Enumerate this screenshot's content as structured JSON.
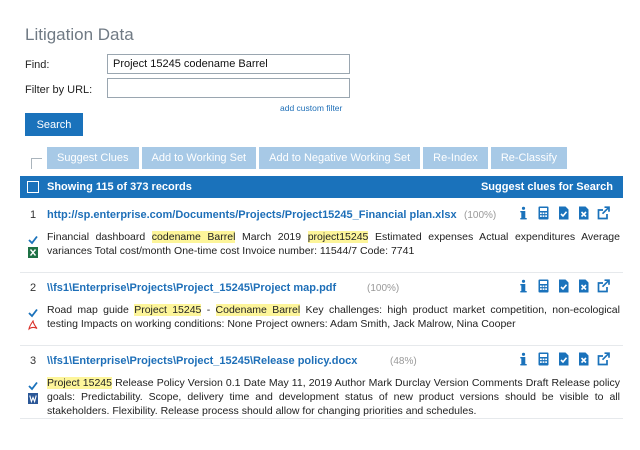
{
  "page_title": "Litigation Data",
  "find": {
    "label": "Find:",
    "value": "Project 15245 codename Barrel"
  },
  "filter_url": {
    "label": "Filter by URL:",
    "value": ""
  },
  "add_filter_link": "add custom filter",
  "search_button": "Search",
  "actions": [
    "Suggest Clues",
    "Add to Working Set",
    "Add to Negative Working Set",
    "Re-Index",
    "Re-Classify"
  ],
  "results_header": {
    "count_text": "Showing 115 of 373 records",
    "suggest_link": "Suggest clues for Search"
  },
  "result_icon_names": [
    "info-icon",
    "calculator-icon",
    "document-check-icon",
    "document-delete-icon",
    "external-link-icon"
  ],
  "colors": {
    "accent": "#1a72bb",
    "action_button": "#a7c9e6",
    "highlight": "#fdf59a",
    "link": "#1e6fb8",
    "check": "#1a72bb",
    "excel": "#1e7145",
    "pdf": "#d9322b",
    "word": "#2b5797"
  },
  "results": [
    {
      "number": "1",
      "url": "http://sp.enterprise.com/Documents/Projects/Project15245_Financial plan.xlsx",
      "score": "(100%)",
      "file_type": "excel-icon",
      "snippet": [
        {
          "t": "Financial dashboard "
        },
        {
          "t": "codename Barrel",
          "hl": true
        },
        {
          "t": " March 2019 "
        },
        {
          "t": "project15245",
          "hl": true
        },
        {
          "t": " Estimated expenses Actual expenditures Average variances Total cost/month One-time cost Invoice number: 11544/7 Code: 7741"
        }
      ]
    },
    {
      "number": "2",
      "url": "\\\\fs1\\Enterprise\\Projects\\Project_15245\\Project map.pdf",
      "score": "(100%)",
      "file_type": "pdf-icon",
      "snippet": [
        {
          "t": "Road map guide "
        },
        {
          "t": "Project 15245",
          "hl": true
        },
        {
          "t": " - "
        },
        {
          "t": "Codename Barrel",
          "hl": true
        },
        {
          "t": " Key challenges: high product market competition, non-ecological testing Impacts on working conditions: None Project owners: Adam Smith, Jack Malrow, Nina Cooper"
        }
      ]
    },
    {
      "number": "3",
      "url": "\\\\fs1\\Enterprise\\Projects\\Project_15245\\Release policy.docx",
      "score": "(48%)",
      "file_type": "word-icon",
      "snippet": [
        {
          "t": "Project 15245",
          "hl": true
        },
        {
          "t": " Release Policy Version 0.1 Date May 11, 2019 Author Mark Durclay Version Comments Draft Release policy goals: Predictability. Scope, delivery time and development status of new product versions should be visible to all stakeholders. Flexibility. Release process should allow for changing priorities and schedules."
        }
      ]
    }
  ]
}
